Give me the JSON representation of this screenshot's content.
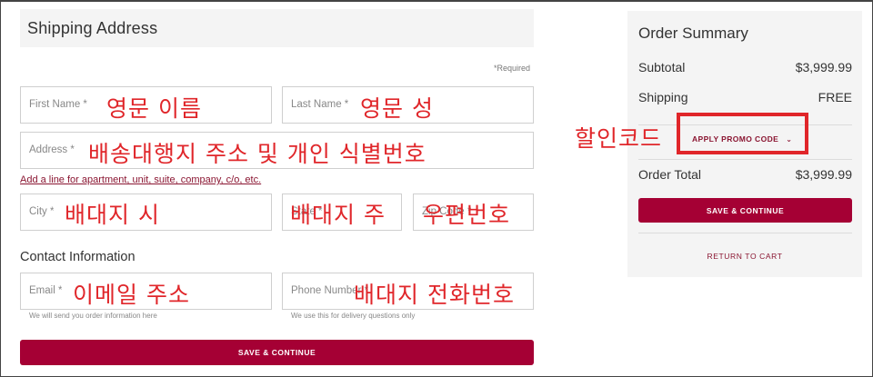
{
  "shipping": {
    "title": "Shipping Address",
    "required_note": "*Required",
    "first_name": {
      "placeholder": "First Name *",
      "annotation": "영문 이름"
    },
    "last_name": {
      "placeholder": "Last Name *",
      "annotation": "영문 성"
    },
    "address": {
      "placeholder": "Address *",
      "annotation": "배송대행지 주소 및 개인 식별번호"
    },
    "add_line_link": "Add a line for apartment, unit, suite, company, c/o, etc.",
    "city": {
      "placeholder": "City *",
      "annotation": "배대지 시"
    },
    "state": {
      "placeholder": "State *",
      "annotation": "배대지 주"
    },
    "zip": {
      "placeholder": "Zip Code *",
      "annotation": "우편번호"
    }
  },
  "contact": {
    "title": "Contact Information",
    "email": {
      "placeholder": "Email *",
      "annotation": "이메일 주소",
      "help": "We will send you order information here"
    },
    "phone": {
      "placeholder": "Phone Number *",
      "annotation": "배대지 전화번호",
      "help": "We use this for delivery questions only"
    }
  },
  "save_continue_label": "SAVE & CONTINUE",
  "summary": {
    "title": "Order Summary",
    "subtotal_label": "Subtotal",
    "subtotal_value": "$3,999.99",
    "shipping_label": "Shipping",
    "shipping_value": "FREE",
    "promo_label": "APPLY PROMO CODE",
    "promo_annotation": "할인코드",
    "total_label": "Order Total",
    "total_value": "$3,999.99",
    "save_continue_label": "SAVE & CONTINUE",
    "return_label": "RETURN TO CART"
  },
  "colors": {
    "brand": "#a50034",
    "annotation": "#e0262a"
  }
}
